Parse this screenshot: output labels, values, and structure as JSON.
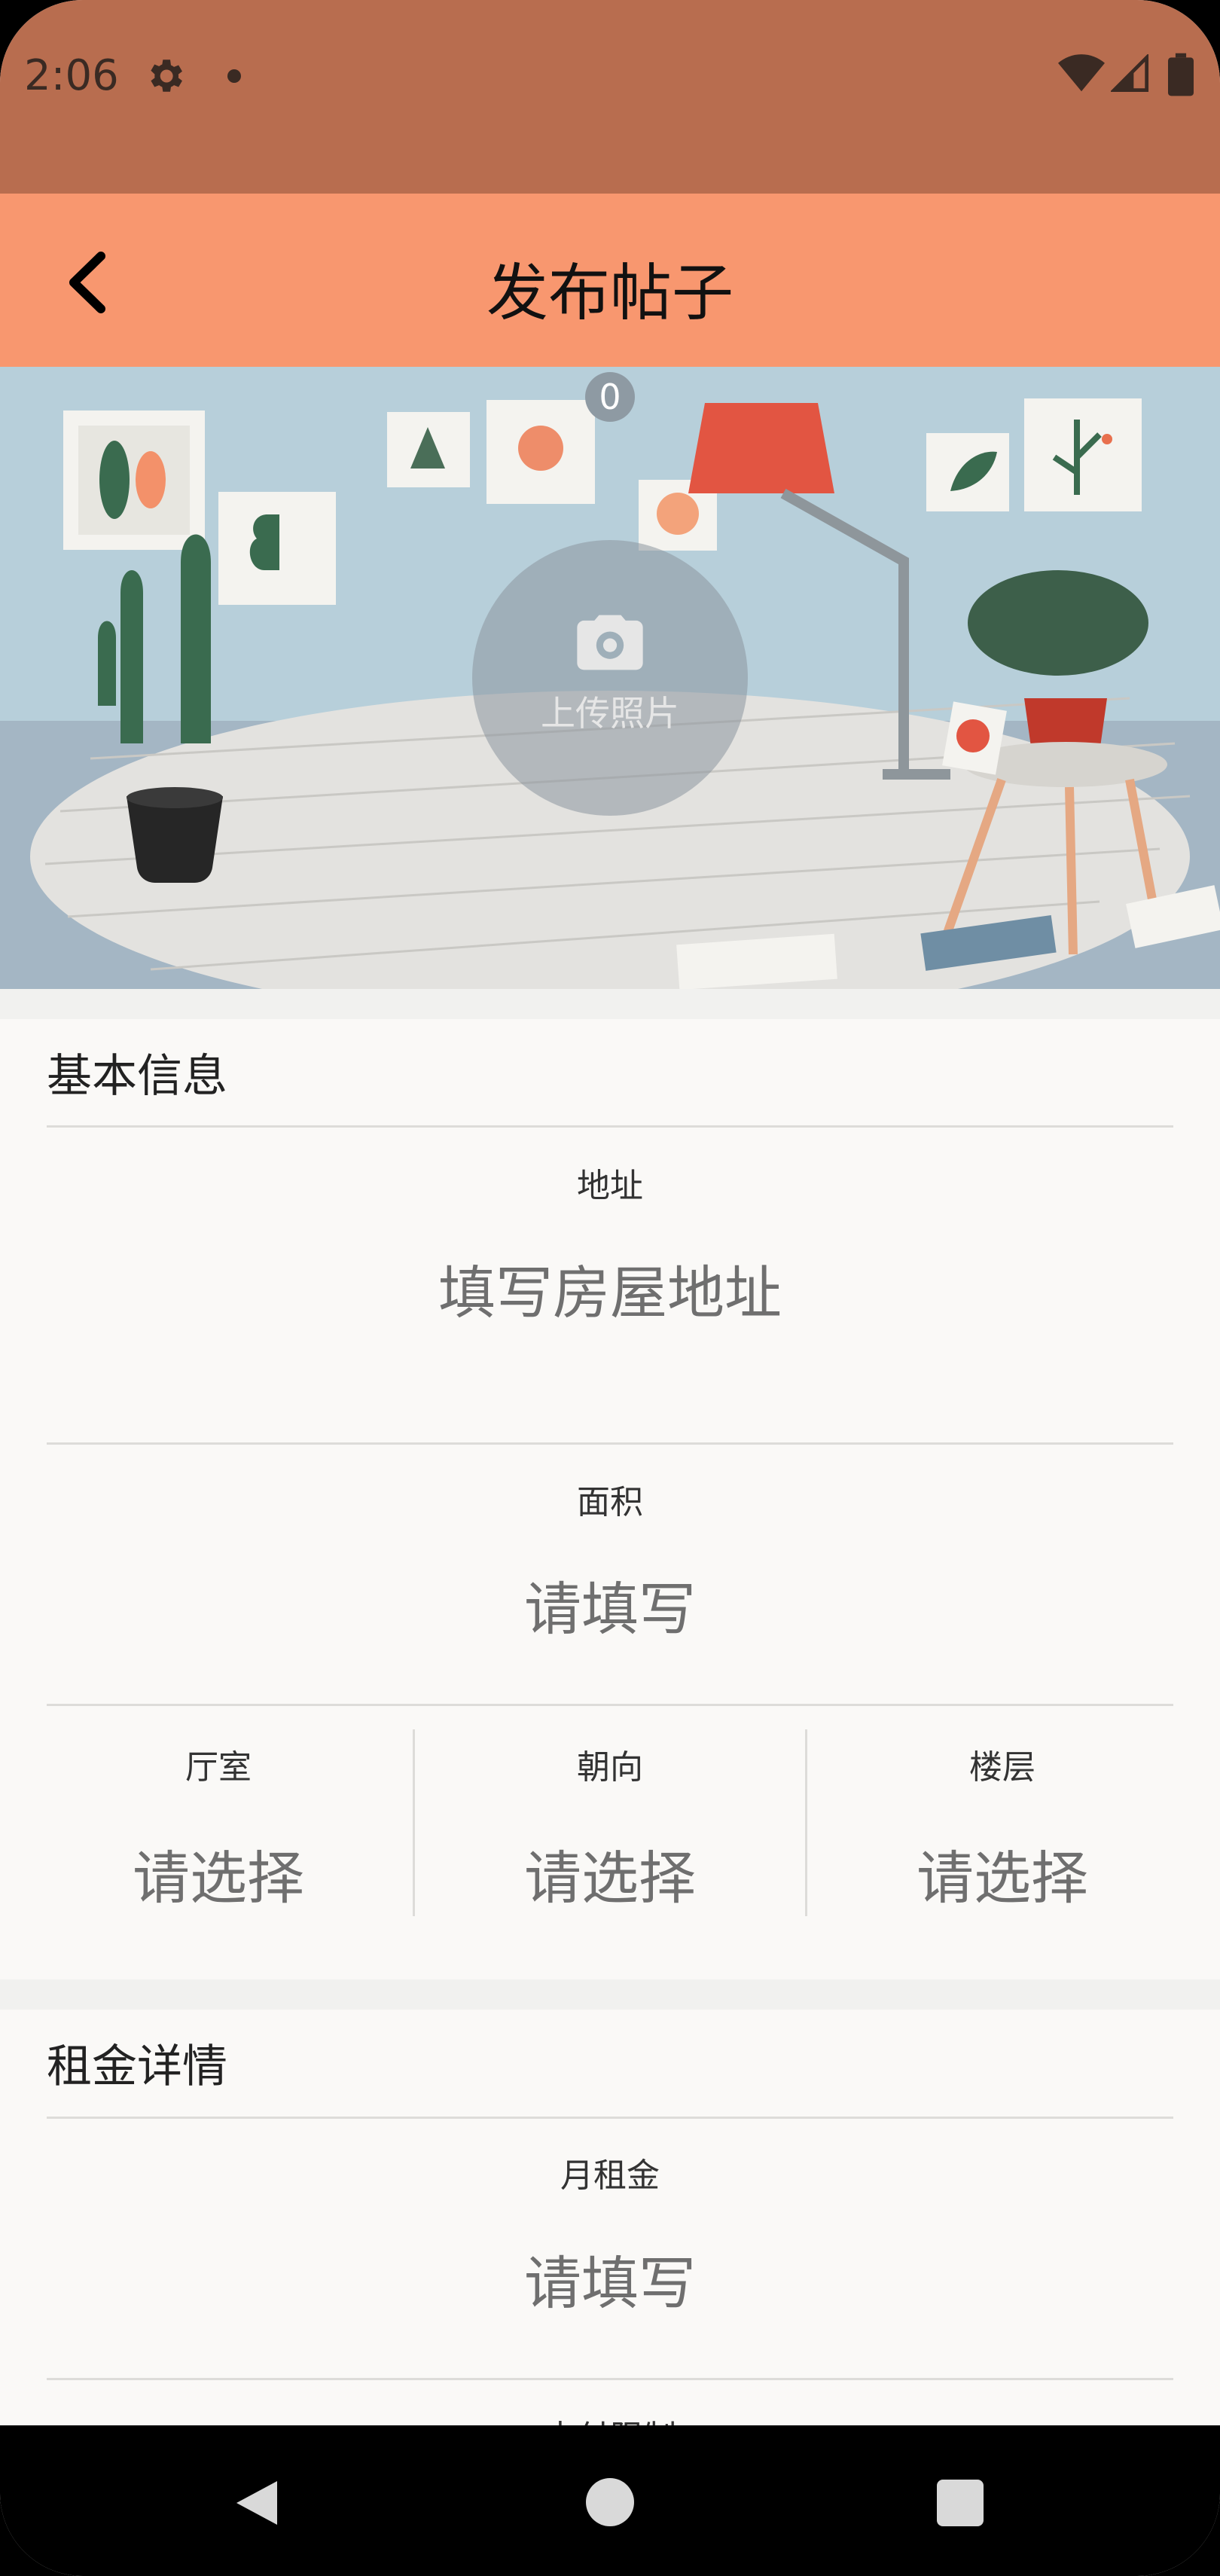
{
  "status_bar": {
    "time": "2:06",
    "icons": [
      "gear-icon",
      "notification-dot-icon",
      "wifi-icon",
      "signal-icon",
      "battery-icon"
    ]
  },
  "header": {
    "title": "发布帖子",
    "back_icon": "chevron-left-icon",
    "background": "#f8976f"
  },
  "hero": {
    "upload_label": "上传照片",
    "photo_count": "0",
    "upload_icon": "camera-icon"
  },
  "basic_info": {
    "title": "基本信息",
    "address": {
      "label": "地址",
      "placeholder": "填写房屋地址"
    },
    "area": {
      "label": "面积",
      "placeholder": "请填写"
    },
    "rooms": {
      "label": "厅室",
      "placeholder": "请选择"
    },
    "orientation": {
      "label": "朝向",
      "placeholder": "请选择"
    },
    "floor": {
      "label": "楼层",
      "placeholder": "请选择"
    }
  },
  "rent_details": {
    "title": "租金详情",
    "monthly_rent": {
      "label": "月租金",
      "placeholder": "请填写"
    },
    "payment_limit": {
      "label": "支付限制"
    }
  },
  "colors": {
    "status_bar": "#b86d4f",
    "accent": "#f8976f",
    "background": "#faf9f7"
  }
}
